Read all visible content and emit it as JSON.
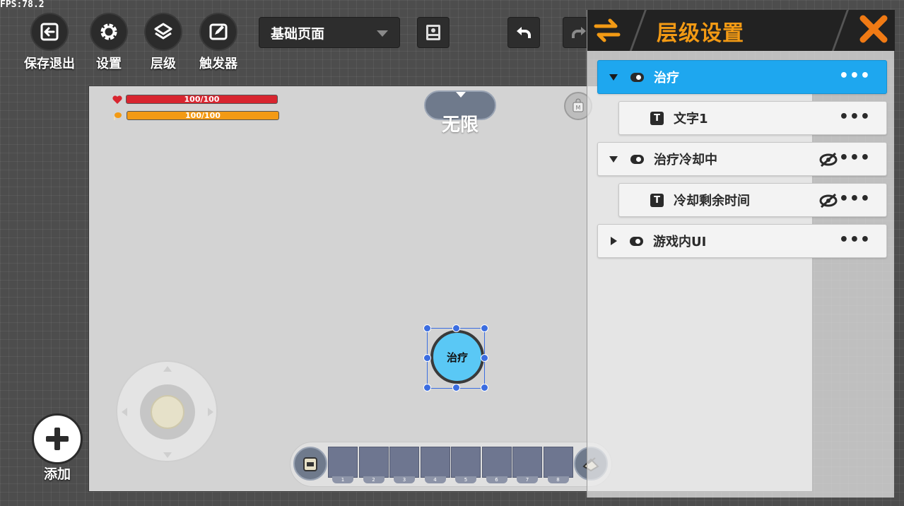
{
  "fps": "FPS:78.2",
  "toolbar": {
    "save_exit": "保存退出",
    "settings": "设置",
    "layers": "层级",
    "triggers": "触发器",
    "page_select": "基础页面"
  },
  "canvas": {
    "hp_text": "100/100",
    "hunger_text": "100/100",
    "mode_text": "无限",
    "heal_button_label": "治疗",
    "hotbar_slots": [
      "1",
      "2",
      "3",
      "4",
      "5",
      "6",
      "7",
      "8"
    ]
  },
  "add": {
    "label": "添加"
  },
  "panel": {
    "title": "层级设置",
    "rows": [
      {
        "name": "治疗",
        "selected": true,
        "hidden": false
      },
      {
        "name": "文字1",
        "selected": false,
        "hidden": false
      },
      {
        "name": "治疗冷却中",
        "selected": false,
        "hidden": true
      },
      {
        "name": "冷却剩余时间",
        "selected": false,
        "hidden": true
      },
      {
        "name": "游戏内UI",
        "selected": false,
        "hidden": false
      }
    ],
    "more": "•••",
    "text_icon": "T"
  },
  "colors": {
    "accent": "#f39a14",
    "selected_row": "#1ea7ef",
    "hp": "#d8252f",
    "heal_button": "#5ac8f5",
    "selection": "#3b6de0"
  },
  "icons": [
    "exit-icon",
    "gear-icon",
    "layers-icon",
    "trigger-edit-icon",
    "image-icon",
    "undo-icon",
    "redo-icon",
    "swap-icon",
    "close-icon",
    "eye-off-icon",
    "heart-icon",
    "drumstick-icon",
    "shop-icon",
    "plus-icon"
  ]
}
